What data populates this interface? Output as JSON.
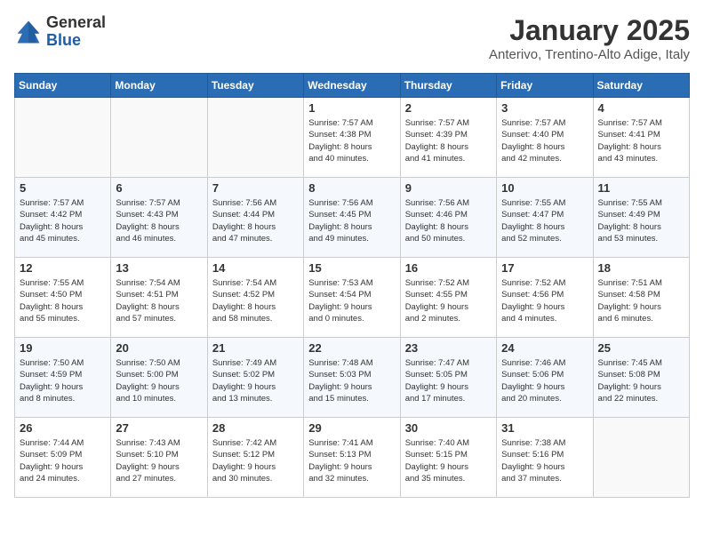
{
  "header": {
    "logo_general": "General",
    "logo_blue": "Blue",
    "month_year": "January 2025",
    "location": "Anterivo, Trentino-Alto Adige, Italy"
  },
  "weekdays": [
    "Sunday",
    "Monday",
    "Tuesday",
    "Wednesday",
    "Thursday",
    "Friday",
    "Saturday"
  ],
  "weeks": [
    [
      {
        "day": "",
        "info": ""
      },
      {
        "day": "",
        "info": ""
      },
      {
        "day": "",
        "info": ""
      },
      {
        "day": "1",
        "info": "Sunrise: 7:57 AM\nSunset: 4:38 PM\nDaylight: 8 hours\nand 40 minutes."
      },
      {
        "day": "2",
        "info": "Sunrise: 7:57 AM\nSunset: 4:39 PM\nDaylight: 8 hours\nand 41 minutes."
      },
      {
        "day": "3",
        "info": "Sunrise: 7:57 AM\nSunset: 4:40 PM\nDaylight: 8 hours\nand 42 minutes."
      },
      {
        "day": "4",
        "info": "Sunrise: 7:57 AM\nSunset: 4:41 PM\nDaylight: 8 hours\nand 43 minutes."
      }
    ],
    [
      {
        "day": "5",
        "info": "Sunrise: 7:57 AM\nSunset: 4:42 PM\nDaylight: 8 hours\nand 45 minutes."
      },
      {
        "day": "6",
        "info": "Sunrise: 7:57 AM\nSunset: 4:43 PM\nDaylight: 8 hours\nand 46 minutes."
      },
      {
        "day": "7",
        "info": "Sunrise: 7:56 AM\nSunset: 4:44 PM\nDaylight: 8 hours\nand 47 minutes."
      },
      {
        "day": "8",
        "info": "Sunrise: 7:56 AM\nSunset: 4:45 PM\nDaylight: 8 hours\nand 49 minutes."
      },
      {
        "day": "9",
        "info": "Sunrise: 7:56 AM\nSunset: 4:46 PM\nDaylight: 8 hours\nand 50 minutes."
      },
      {
        "day": "10",
        "info": "Sunrise: 7:55 AM\nSunset: 4:47 PM\nDaylight: 8 hours\nand 52 minutes."
      },
      {
        "day": "11",
        "info": "Sunrise: 7:55 AM\nSunset: 4:49 PM\nDaylight: 8 hours\nand 53 minutes."
      }
    ],
    [
      {
        "day": "12",
        "info": "Sunrise: 7:55 AM\nSunset: 4:50 PM\nDaylight: 8 hours\nand 55 minutes."
      },
      {
        "day": "13",
        "info": "Sunrise: 7:54 AM\nSunset: 4:51 PM\nDaylight: 8 hours\nand 57 minutes."
      },
      {
        "day": "14",
        "info": "Sunrise: 7:54 AM\nSunset: 4:52 PM\nDaylight: 8 hours\nand 58 minutes."
      },
      {
        "day": "15",
        "info": "Sunrise: 7:53 AM\nSunset: 4:54 PM\nDaylight: 9 hours\nand 0 minutes."
      },
      {
        "day": "16",
        "info": "Sunrise: 7:52 AM\nSunset: 4:55 PM\nDaylight: 9 hours\nand 2 minutes."
      },
      {
        "day": "17",
        "info": "Sunrise: 7:52 AM\nSunset: 4:56 PM\nDaylight: 9 hours\nand 4 minutes."
      },
      {
        "day": "18",
        "info": "Sunrise: 7:51 AM\nSunset: 4:58 PM\nDaylight: 9 hours\nand 6 minutes."
      }
    ],
    [
      {
        "day": "19",
        "info": "Sunrise: 7:50 AM\nSunset: 4:59 PM\nDaylight: 9 hours\nand 8 minutes."
      },
      {
        "day": "20",
        "info": "Sunrise: 7:50 AM\nSunset: 5:00 PM\nDaylight: 9 hours\nand 10 minutes."
      },
      {
        "day": "21",
        "info": "Sunrise: 7:49 AM\nSunset: 5:02 PM\nDaylight: 9 hours\nand 13 minutes."
      },
      {
        "day": "22",
        "info": "Sunrise: 7:48 AM\nSunset: 5:03 PM\nDaylight: 9 hours\nand 15 minutes."
      },
      {
        "day": "23",
        "info": "Sunrise: 7:47 AM\nSunset: 5:05 PM\nDaylight: 9 hours\nand 17 minutes."
      },
      {
        "day": "24",
        "info": "Sunrise: 7:46 AM\nSunset: 5:06 PM\nDaylight: 9 hours\nand 20 minutes."
      },
      {
        "day": "25",
        "info": "Sunrise: 7:45 AM\nSunset: 5:08 PM\nDaylight: 9 hours\nand 22 minutes."
      }
    ],
    [
      {
        "day": "26",
        "info": "Sunrise: 7:44 AM\nSunset: 5:09 PM\nDaylight: 9 hours\nand 24 minutes."
      },
      {
        "day": "27",
        "info": "Sunrise: 7:43 AM\nSunset: 5:10 PM\nDaylight: 9 hours\nand 27 minutes."
      },
      {
        "day": "28",
        "info": "Sunrise: 7:42 AM\nSunset: 5:12 PM\nDaylight: 9 hours\nand 30 minutes."
      },
      {
        "day": "29",
        "info": "Sunrise: 7:41 AM\nSunset: 5:13 PM\nDaylight: 9 hours\nand 32 minutes."
      },
      {
        "day": "30",
        "info": "Sunrise: 7:40 AM\nSunset: 5:15 PM\nDaylight: 9 hours\nand 35 minutes."
      },
      {
        "day": "31",
        "info": "Sunrise: 7:38 AM\nSunset: 5:16 PM\nDaylight: 9 hours\nand 37 minutes."
      },
      {
        "day": "",
        "info": ""
      }
    ]
  ]
}
